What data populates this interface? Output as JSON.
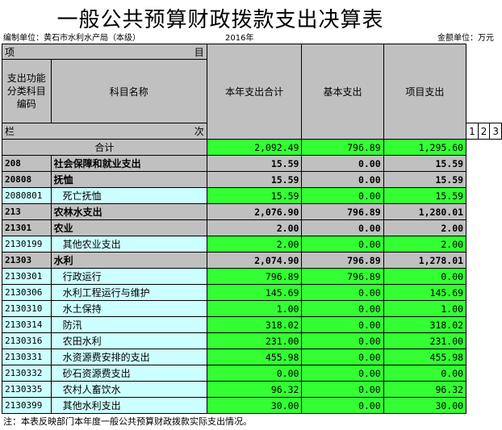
{
  "title": "一般公共预算财政拨款支出决算表",
  "unit_label": "编制单位：黄石市水利水产局（本级）",
  "year_label": "2016年",
  "money_label": "金额单位：万元",
  "header": {
    "xiang": "项",
    "mu": "目",
    "code_col": "支出功能分类科目编码",
    "name_col": "科目名称",
    "total_col": "本年支出合计",
    "basic_col": "基本支出",
    "project_col": "项目支出",
    "lan": "栏",
    "ci": "次",
    "idx1": "1",
    "idx2": "2",
    "idx3": "3"
  },
  "total_row": {
    "label": "合计",
    "total": "2,092.49",
    "basic": "796.89",
    "project": "1,295.60"
  },
  "rows": [
    {
      "code": "208",
      "name": "社会保障和就业支出",
      "total": "15.59",
      "basic": "0.00",
      "project": "15.59"
    },
    {
      "code": "20808",
      "name": "抚恤",
      "total": "15.59",
      "basic": "0.00",
      "project": "15.59"
    },
    {
      "code": "2080801",
      "name": "死亡抚恤",
      "total": "15.59",
      "basic": "0.00",
      "project": "15.59"
    },
    {
      "code": "213",
      "name": "农林水支出",
      "total": "2,076.90",
      "basic": "796.89",
      "project": "1,280.01"
    },
    {
      "code": "21301",
      "name": "农业",
      "total": "2.00",
      "basic": "0.00",
      "project": "2.00"
    },
    {
      "code": "2130199",
      "name": "其他农业支出",
      "total": "2.00",
      "basic": "0.00",
      "project": "2.00"
    },
    {
      "code": "21303",
      "name": "水利",
      "total": "2,074.90",
      "basic": "796.89",
      "project": "1,278.01"
    },
    {
      "code": "2130301",
      "name": "行政运行",
      "total": "796.89",
      "basic": "796.89",
      "project": "0.00"
    },
    {
      "code": "2130306",
      "name": "水利工程运行与维护",
      "total": "145.69",
      "basic": "0.00",
      "project": "145.69"
    },
    {
      "code": "2130310",
      "name": "水土保持",
      "total": "1.00",
      "basic": "0.00",
      "project": "1.00"
    },
    {
      "code": "2130314",
      "name": "防汛",
      "total": "318.02",
      "basic": "0.00",
      "project": "318.02"
    },
    {
      "code": "2130316",
      "name": "农田水利",
      "total": "231.00",
      "basic": "0.00",
      "project": "231.00"
    },
    {
      "code": "2130331",
      "name": "水资源费安排的支出",
      "total": "455.98",
      "basic": "0.00",
      "project": "455.98"
    },
    {
      "code": "2130332",
      "name": "砂石资源费支出",
      "total": "0.00",
      "basic": "0.00",
      "project": "0.00"
    },
    {
      "code": "2130335",
      "name": "农村人畜饮水",
      "total": "96.32",
      "basic": "0.00",
      "project": "96.32"
    },
    {
      "code": "2130399",
      "name": "其他水利支出",
      "total": "30.00",
      "basic": "0.00",
      "project": "30.00"
    }
  ],
  "note": "注：本表反映部门本年度一般公共预算财政拨款实际支出情况。",
  "colors": {
    "gray": "#c0c0c0",
    "green": "#33ff33",
    "cyan": "#ccffff"
  }
}
